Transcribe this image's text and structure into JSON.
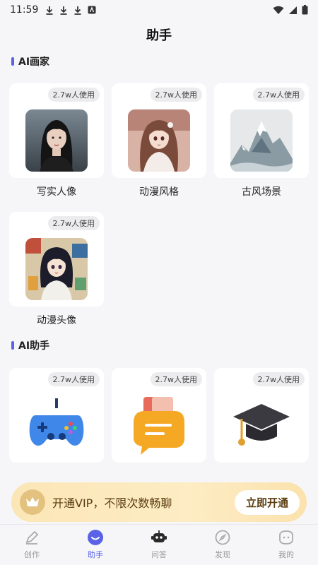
{
  "status_bar": {
    "time": "11:59"
  },
  "page": {
    "title": "助手"
  },
  "sections": {
    "painter": {
      "title": "AI画家"
    },
    "assistant": {
      "title": "AI助手"
    }
  },
  "painter_cards": [
    {
      "badge": "2.7w人使用",
      "label": "写实人像",
      "image": "realistic-portrait-image"
    },
    {
      "badge": "2.7w人使用",
      "label": "动漫风格",
      "image": "anime-style-image"
    },
    {
      "badge": "2.7w人使用",
      "label": "古风场景",
      "image": "ancient-landscape-image"
    },
    {
      "badge": "2.7w人使用",
      "label": "动漫头像",
      "image": "anime-avatar-image"
    }
  ],
  "assistant_cards": [
    {
      "badge": "2.7w人使用",
      "icon": "gamepad-icon"
    },
    {
      "badge": "2.7w人使用",
      "icon": "book-chat-icon"
    },
    {
      "badge": "2.7w人使用",
      "icon": "graduation-cap-icon"
    }
  ],
  "vip_banner": {
    "text": "开通VIP，不限次数畅聊",
    "button": "立即开通",
    "icon": "crown-icon"
  },
  "tabbar": [
    {
      "label": "创作",
      "icon": "pencil-icon",
      "active": false
    },
    {
      "label": "助手",
      "icon": "smile-icon",
      "active": true
    },
    {
      "label": "问答",
      "icon": "robot-icon",
      "active": false
    },
    {
      "label": "发现",
      "icon": "compass-icon",
      "active": false
    },
    {
      "label": "我的",
      "icon": "face-icon",
      "active": false
    }
  ],
  "colors": {
    "accent": "#5a63e6",
    "vip_gold": "#e3c27f",
    "background": "#f6f6f8"
  }
}
